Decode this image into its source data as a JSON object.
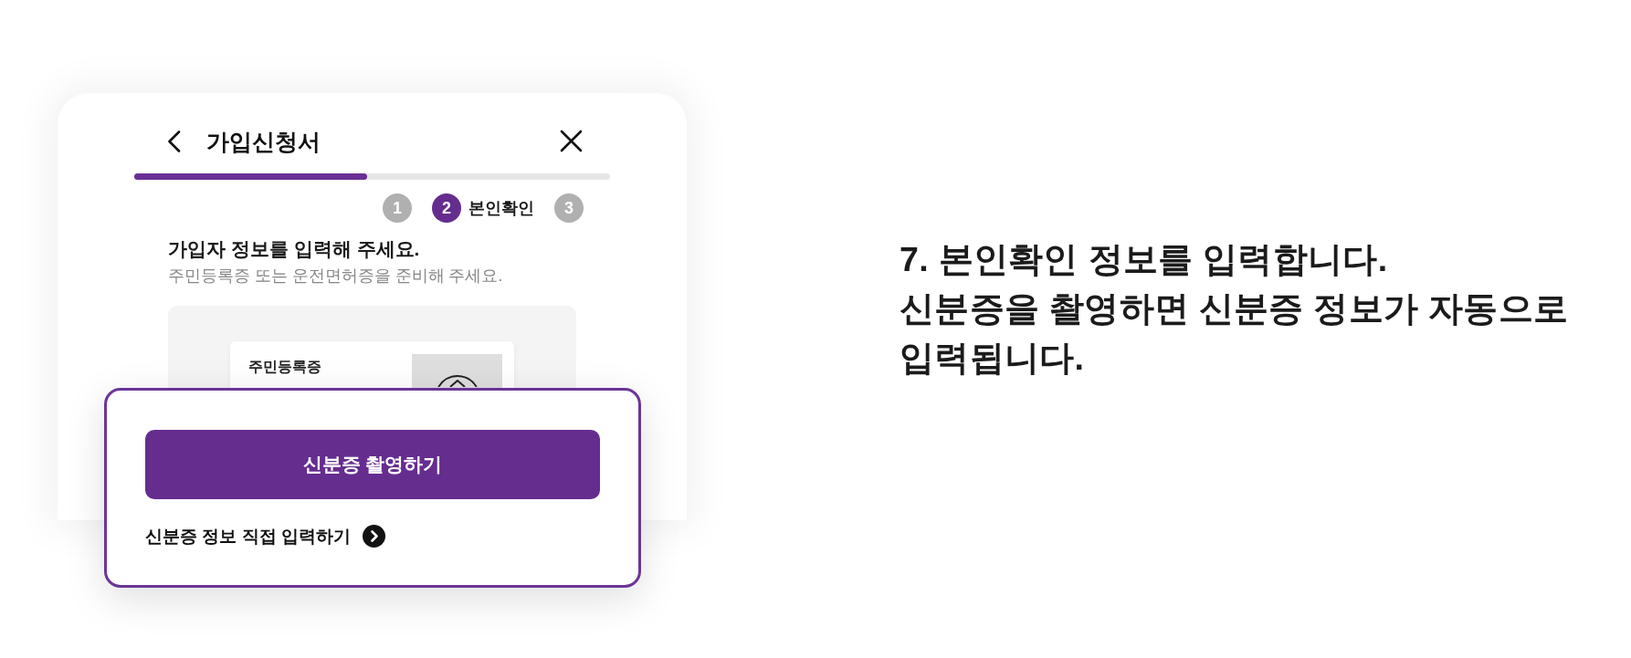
{
  "screen": {
    "title": "가입신청서",
    "progress": {
      "level": 0.49
    },
    "steps": [
      {
        "number": "1",
        "selected": false
      },
      {
        "number": "2",
        "label": "본인확인",
        "selected": true
      },
      {
        "number": "3",
        "selected": false
      }
    ],
    "heading": "가입자 정보를 입력해 주세요.",
    "subtitle": "주민등록증 또는 운전면허증을 준비해 주세요.",
    "id_card": {
      "label": "주민등록증"
    }
  },
  "bottom_sheet": {
    "primary_button": "신분증 촬영하기",
    "link": "신분증 정보 직접 입력하기"
  },
  "caption": {
    "title": "7. 본인확인 정보를 입력합니다.",
    "description": "신분증을 촬영하면 신분증 정보가 자동으로 입력됩니다."
  }
}
